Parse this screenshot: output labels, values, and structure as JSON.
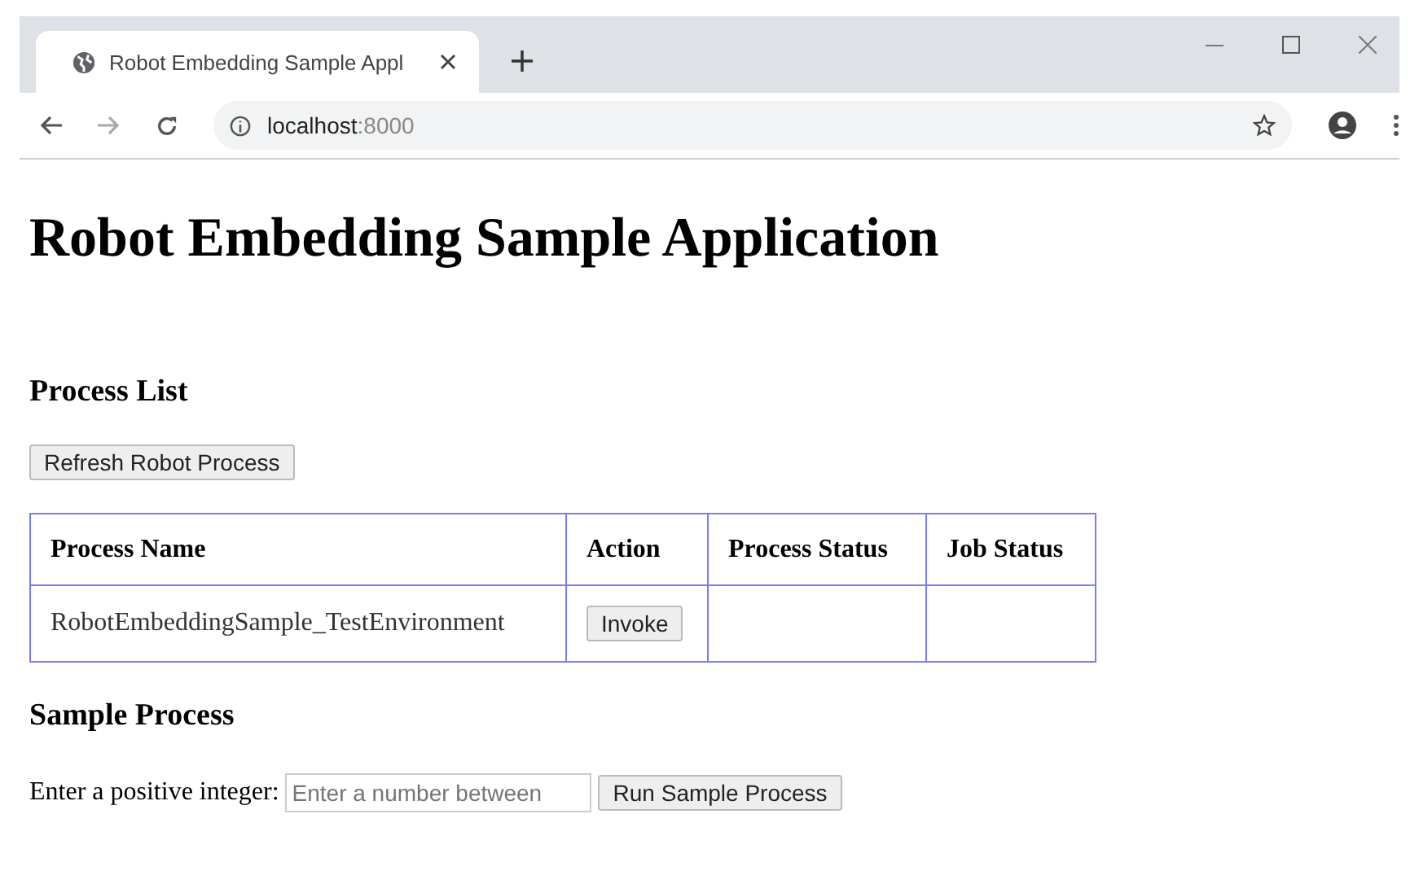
{
  "browser": {
    "tab": {
      "title": "Robot Embedding Sample Appl",
      "selected": true
    },
    "address": {
      "host": "localhost",
      "port": ":8000"
    }
  },
  "page": {
    "title": "Robot Embedding Sample Application",
    "process_list": {
      "heading": "Process List",
      "refresh_button": "Refresh Robot Process",
      "table": {
        "columns": [
          "Process Name",
          "Action",
          "Process Status",
          "Job Status"
        ],
        "rows": [
          {
            "process_name": "RobotEmbeddingSample_TestEnvironment",
            "action": "Invoke"
          }
        ]
      }
    },
    "sample_process": {
      "heading": "Sample Process",
      "label": "Enter a positive integer:",
      "input": {
        "placeholder": "Enter a number between"
      },
      "run_button": "Run Sample Process"
    }
  }
}
